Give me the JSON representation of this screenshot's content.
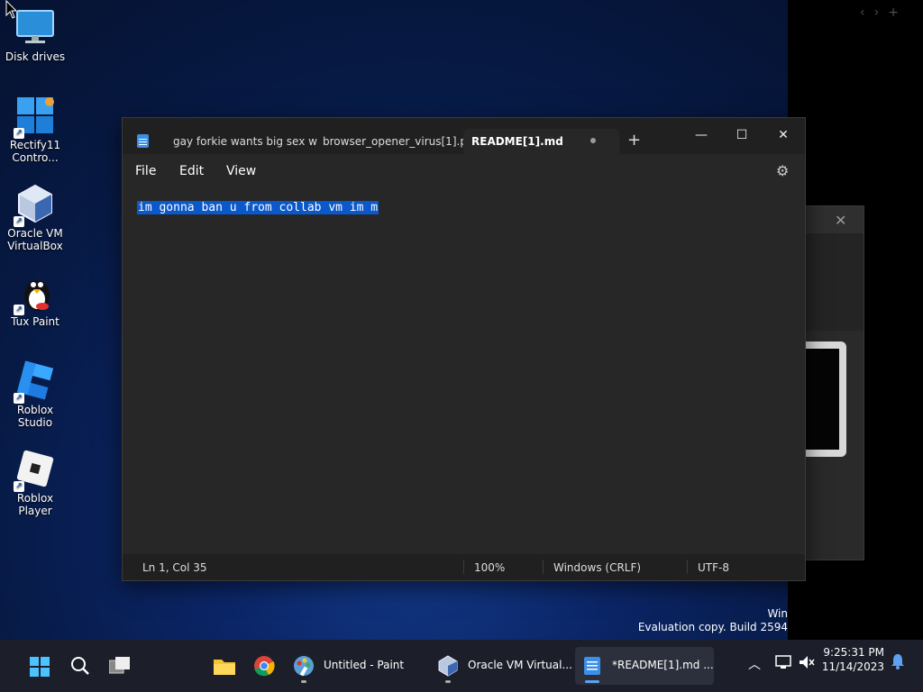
{
  "desktop": {
    "icons": [
      {
        "label": "Disk drives",
        "icon": "monitor-icon"
      },
      {
        "label": "Rectify11 Contro...",
        "icon": "windows-control-icon"
      },
      {
        "label": "Oracle VM VirtualBox",
        "icon": "virtualbox-icon"
      },
      {
        "label": "Tux Paint",
        "icon": "penguin-icon"
      },
      {
        "label": "Roblox Studio",
        "icon": "roblox-studio-icon"
      },
      {
        "label": "Roblox Player",
        "icon": "roblox-player-icon"
      }
    ]
  },
  "notepad": {
    "tabs": [
      {
        "label": "gay forkie wants big sex witl"
      },
      {
        "label": "browser_opener_virus[1].py"
      },
      {
        "label": "README[1].md",
        "unsaved": true
      }
    ],
    "menu": {
      "file": "File",
      "edit": "Edit",
      "view": "View"
    },
    "content": "im gonna ban u from collab vm im m",
    "status": {
      "position": "Ln 1, Col 35",
      "zoom": "100%",
      "line_ending": "Windows (CRLF)",
      "encoding": "UTF-8"
    }
  },
  "watermark": {
    "line1": "Win",
    "line2": "Evaluation copy. Build 2594"
  },
  "taskbar": {
    "apps": [
      {
        "label": "Untitled - Paint",
        "icon": "paint-icon"
      },
      {
        "label": "Oracle VM Virtual...",
        "icon": "virtualbox-icon"
      },
      {
        "label": "*README[1].md ...",
        "icon": "notepad-icon",
        "active": true
      }
    ],
    "time": "9:25:31 PM",
    "date": "11/14/2023"
  },
  "colors": {
    "selection": "#0a58ca",
    "accent": "#5ea1f0",
    "window_bg": "#272727"
  }
}
